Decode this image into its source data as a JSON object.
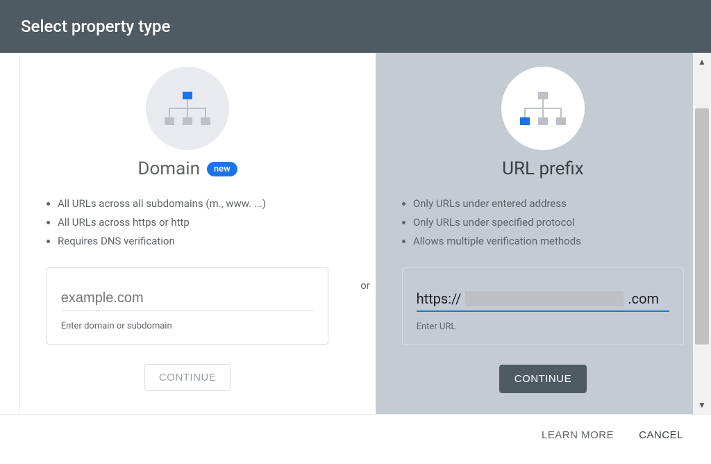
{
  "header": {
    "title": "Select property type"
  },
  "separator": "or",
  "left": {
    "title": "Domain",
    "badge": "new",
    "bullets": [
      "All URLs across all subdomains (m., www. ...)",
      "All URLs across https or http",
      "Requires DNS verification"
    ],
    "placeholder": "example.com",
    "helper": "Enter domain or subdomain",
    "continue": "CONTINUE"
  },
  "right": {
    "title": "URL prefix",
    "bullets": [
      "Only URLs under entered address",
      "Only URLs under specified protocol",
      "Allows multiple verification methods"
    ],
    "value_prefix": "https://",
    "value_suffix": ".com",
    "helper": "Enter URL",
    "continue": "CONTINUE"
  },
  "footer": {
    "learn": "LEARN MORE",
    "cancel": "CANCEL"
  }
}
